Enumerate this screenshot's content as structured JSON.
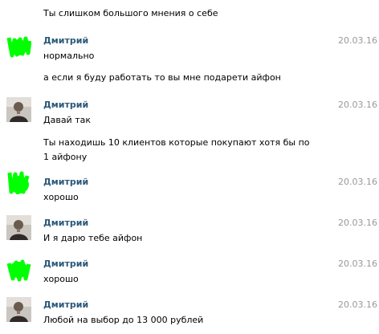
{
  "messages": [
    {
      "kind": "text",
      "text": "Ты слишком большого мнения о себе"
    },
    {
      "kind": "header",
      "avatar": "green-scribble",
      "name": "Дмитрий",
      "date": "20.03.16"
    },
    {
      "kind": "text",
      "text": "нормально"
    },
    {
      "kind": "text",
      "text": "а если я буду работать то вы мне подарети айфон"
    },
    {
      "kind": "header",
      "avatar": "photo",
      "name": "Дмитрий",
      "date": "20.03.16"
    },
    {
      "kind": "text",
      "text": "Давай так"
    },
    {
      "kind": "text",
      "text": "Ты находишь 10 клиентов которые покупают хотя бы по 1 айфону"
    },
    {
      "kind": "header",
      "avatar": "green-scribble",
      "name": "Дмитрий",
      "date": "20.03.16"
    },
    {
      "kind": "text",
      "text": "хорошо"
    },
    {
      "kind": "header",
      "avatar": "photo",
      "name": "Дмитрий",
      "date": "20.03.16"
    },
    {
      "kind": "text",
      "text": "И я дарю тебе айфон"
    },
    {
      "kind": "header",
      "avatar": "green-scribble",
      "name": "Дмитрий",
      "date": "20.03.16"
    },
    {
      "kind": "text",
      "text": "хорошо"
    },
    {
      "kind": "header",
      "avatar": "photo",
      "name": "Дмитрий",
      "date": "20.03.16"
    },
    {
      "kind": "text",
      "text": "Любой на выбор до 13 000 рублей"
    }
  ],
  "colors": {
    "name": "#2b587a",
    "date": "#999999",
    "scribble": "#00ff00"
  }
}
